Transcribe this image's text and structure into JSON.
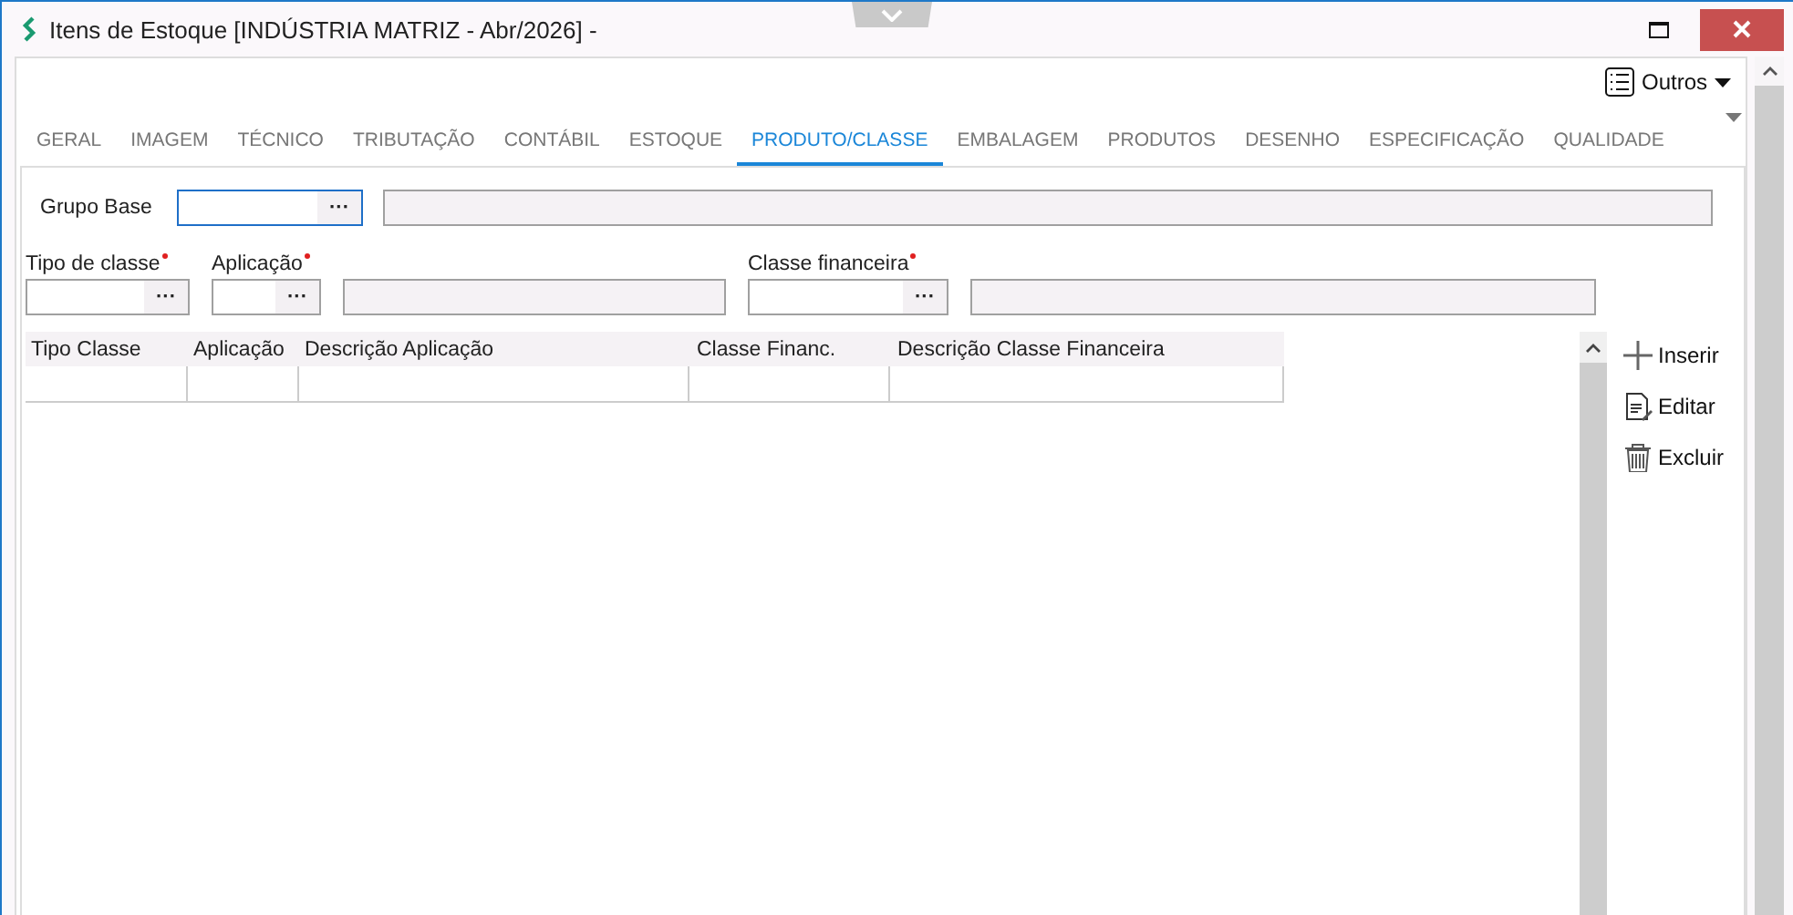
{
  "window": {
    "title": "Itens de Estoque [INDÚSTRIA MATRIZ - Abr/2026]  -"
  },
  "toolbar": {
    "menu_button": "Outros"
  },
  "tabs": [
    {
      "label": "GERAL",
      "selected": false
    },
    {
      "label": "IMAGEM",
      "selected": false
    },
    {
      "label": "TÉCNICO",
      "selected": false
    },
    {
      "label": "TRIBUTAÇÃO",
      "selected": false
    },
    {
      "label": "CONTÁBIL",
      "selected": false
    },
    {
      "label": "ESTOQUE",
      "selected": false
    },
    {
      "label": "PRODUTO/CLASSE",
      "selected": true
    },
    {
      "label": "EMBALAGEM",
      "selected": false
    },
    {
      "label": "PRODUTOS",
      "selected": false
    },
    {
      "label": "DESENHO",
      "selected": false
    },
    {
      "label": "ESPECIFICAÇÃO",
      "selected": false
    },
    {
      "label": "QUALIDADE",
      "selected": false
    }
  ],
  "grupo_base": {
    "label": "Grupo Base",
    "lookup": "···"
  },
  "fields": [
    {
      "label": "Tipo de classe",
      "required": true,
      "lookup": "···",
      "has_description": false
    },
    {
      "label": "Aplicação",
      "required": true,
      "lookup": "···",
      "has_description": true
    },
    {
      "label": "Classe financeira",
      "required": true,
      "lookup": "···",
      "has_description": true
    }
  ],
  "table": {
    "columns": [
      "Tipo Classe",
      "Aplicação",
      "Descrição Aplicação",
      "Classe Financ.",
      "Descrição Classe Financeira"
    ]
  },
  "actions": [
    {
      "kind": "insert",
      "label": "Inserir"
    },
    {
      "kind": "edit",
      "label": "Editar"
    },
    {
      "kind": "delete",
      "label": "Excluir"
    }
  ]
}
